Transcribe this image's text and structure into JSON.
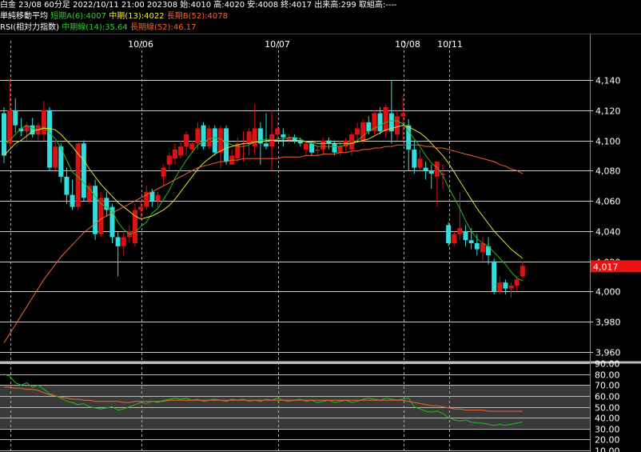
{
  "header": {
    "line1": "白金 23/08 60分足 2022/10/11 21:00 202308 始:4010 高:4020 安:4008 終:4017 出来高:299 取組高:----",
    "ma_title": "単純移動平均",
    "ma_short": "短期A(6):4007",
    "ma_mid": "中期(13):4022",
    "ma_long": "長期B(52):4078",
    "rsi_title": "RSI(相対力指数)",
    "rsi_mid": "中期線(14):35.64",
    "rsi_long": "長期線(52):46.17"
  },
  "colors": {
    "background": "#000000",
    "up": "#dd1111",
    "down": "#33dddd",
    "ma_short": "#22bb22",
    "ma_mid": "#dddd33",
    "ma_long": "#ee6633",
    "rsi_mid": "#22bb22",
    "rsi_long": "#ee6633",
    "price_tag": "#ee1111"
  },
  "chart_data": [
    {
      "type": "candlestick",
      "title": "白金 23/08 60分足",
      "x_labels": [
        "10/06",
        "10/07",
        "10/08",
        "10/11"
      ],
      "y_ticks": [
        3960,
        3980,
        4000,
        4020,
        4040,
        4060,
        4080,
        4100,
        4120,
        4140
      ],
      "ylim": [
        3955,
        4155
      ],
      "last_price_label": "4,017",
      "candles": [
        {
          "o": 4118,
          "h": 4122,
          "l": 4085,
          "c": 4090
        },
        {
          "o": 4098,
          "h": 4140,
          "l": 4096,
          "c": 4120
        },
        {
          "o": 4120,
          "h": 4128,
          "l": 4105,
          "c": 4110
        },
        {
          "o": 4108,
          "h": 4115,
          "l": 4103,
          "c": 4106
        },
        {
          "o": 4106,
          "h": 4112,
          "l": 4100,
          "c": 4110
        },
        {
          "o": 4110,
          "h": 4115,
          "l": 4102,
          "c": 4104
        },
        {
          "o": 4104,
          "h": 4112,
          "l": 4100,
          "c": 4110
        },
        {
          "o": 4104,
          "h": 4126,
          "l": 4100,
          "c": 4120
        },
        {
          "o": 4120,
          "h": 4122,
          "l": 4080,
          "c": 4082
        },
        {
          "o": 4082,
          "h": 4100,
          "l": 4080,
          "c": 4096
        },
        {
          "o": 4096,
          "h": 4098,
          "l": 4072,
          "c": 4076
        },
        {
          "o": 4076,
          "h": 4082,
          "l": 4058,
          "c": 4064
        },
        {
          "o": 4064,
          "h": 4074,
          "l": 4054,
          "c": 4056
        },
        {
          "o": 4056,
          "h": 4098,
          "l": 4054,
          "c": 4098
        },
        {
          "o": 4098,
          "h": 4100,
          "l": 4060,
          "c": 4062
        },
        {
          "o": 4060,
          "h": 4072,
          "l": 4058,
          "c": 4070
        },
        {
          "o": 4070,
          "h": 4074,
          "l": 4034,
          "c": 4038
        },
        {
          "o": 4038,
          "h": 4066,
          "l": 4036,
          "c": 4062
        },
        {
          "o": 4062,
          "h": 4066,
          "l": 4050,
          "c": 4054
        },
        {
          "o": 4056,
          "h": 4058,
          "l": 4032,
          "c": 4036
        },
        {
          "o": 4036,
          "h": 4040,
          "l": 4010,
          "c": 4030
        },
        {
          "o": 4030,
          "h": 4040,
          "l": 4024,
          "c": 4036
        },
        {
          "o": 4036,
          "h": 4044,
          "l": 4032,
          "c": 4040
        },
        {
          "o": 4032,
          "h": 4058,
          "l": 4030,
          "c": 4054
        },
        {
          "o": 4054,
          "h": 4060,
          "l": 4048,
          "c": 4056
        },
        {
          "o": 4056,
          "h": 4070,
          "l": 4054,
          "c": 4066
        },
        {
          "o": 4066,
          "h": 4068,
          "l": 4056,
          "c": 4060
        },
        {
          "o": 4060,
          "h": 4066,
          "l": 4056,
          "c": 4064
        },
        {
          "o": 4076,
          "h": 4084,
          "l": 4070,
          "c": 4082
        },
        {
          "o": 4084,
          "h": 4092,
          "l": 4080,
          "c": 4090
        },
        {
          "o": 4088,
          "h": 4098,
          "l": 4084,
          "c": 4094
        },
        {
          "o": 4090,
          "h": 4100,
          "l": 4088,
          "c": 4096
        },
        {
          "o": 4096,
          "h": 4106,
          "l": 4090,
          "c": 4104
        },
        {
          "o": 4094,
          "h": 4100,
          "l": 4092,
          "c": 4098
        },
        {
          "o": 4098,
          "h": 4112,
          "l": 4094,
          "c": 4108
        },
        {
          "o": 4110,
          "h": 4112,
          "l": 4094,
          "c": 4096
        },
        {
          "o": 4096,
          "h": 4110,
          "l": 4094,
          "c": 4108
        },
        {
          "o": 4108,
          "h": 4110,
          "l": 4090,
          "c": 4092
        },
        {
          "o": 4092,
          "h": 4110,
          "l": 4082,
          "c": 4108
        },
        {
          "o": 4108,
          "h": 4110,
          "l": 4084,
          "c": 4086
        },
        {
          "o": 4084,
          "h": 4094,
          "l": 4084,
          "c": 4090
        },
        {
          "o": 4088,
          "h": 4102,
          "l": 4086,
          "c": 4098
        },
        {
          "o": 4098,
          "h": 4106,
          "l": 4086,
          "c": 4098
        },
        {
          "o": 4098,
          "h": 4108,
          "l": 4090,
          "c": 4106
        },
        {
          "o": 4096,
          "h": 4124,
          "l": 4090,
          "c": 4108
        },
        {
          "o": 4108,
          "h": 4112,
          "l": 4084,
          "c": 4098
        },
        {
          "o": 4098,
          "h": 4118,
          "l": 4094,
          "c": 4096
        },
        {
          "o": 4096,
          "h": 4120,
          "l": 4080,
          "c": 4104
        },
        {
          "o": 4104,
          "h": 4112,
          "l": 4100,
          "c": 4108
        },
        {
          "o": 4104,
          "h": 4108,
          "l": 4096,
          "c": 4102
        },
        {
          "o": 4100,
          "h": 4104,
          "l": 4098,
          "c": 4102
        },
        {
          "o": 4102,
          "h": 4104,
          "l": 4098,
          "c": 4100
        },
        {
          "o": 4100,
          "h": 4102,
          "l": 4096,
          "c": 4098
        },
        {
          "o": 4094,
          "h": 4100,
          "l": 4090,
          "c": 4098
        },
        {
          "o": 4098,
          "h": 4100,
          "l": 4090,
          "c": 4092
        },
        {
          "o": 4094,
          "h": 4096,
          "l": 4090,
          "c": 4094
        },
        {
          "o": 4094,
          "h": 4102,
          "l": 4090,
          "c": 4100
        },
        {
          "o": 4100,
          "h": 4102,
          "l": 4094,
          "c": 4098
        },
        {
          "o": 4098,
          "h": 4100,
          "l": 4090,
          "c": 4092
        },
        {
          "o": 4092,
          "h": 4100,
          "l": 4090,
          "c": 4096
        },
        {
          "o": 4096,
          "h": 4102,
          "l": 4092,
          "c": 4100
        },
        {
          "o": 4094,
          "h": 4106,
          "l": 4090,
          "c": 4104
        },
        {
          "o": 4104,
          "h": 4112,
          "l": 4100,
          "c": 4108
        },
        {
          "o": 4100,
          "h": 4114,
          "l": 4098,
          "c": 4112
        },
        {
          "o": 4112,
          "h": 4116,
          "l": 4104,
          "c": 4106
        },
        {
          "o": 4106,
          "h": 4120,
          "l": 4104,
          "c": 4118
        },
        {
          "o": 4118,
          "h": 4122,
          "l": 4104,
          "c": 4106
        },
        {
          "o": 4106,
          "h": 4124,
          "l": 4102,
          "c": 4122
        },
        {
          "o": 4118,
          "h": 4140,
          "l": 4098,
          "c": 4106
        },
        {
          "o": 4104,
          "h": 4120,
          "l": 4100,
          "c": 4116
        },
        {
          "o": 4116,
          "h": 4130,
          "l": 4100,
          "c": 4118
        },
        {
          "o": 4110,
          "h": 4114,
          "l": 4080,
          "c": 4094
        },
        {
          "o": 4094,
          "h": 4100,
          "l": 4078,
          "c": 4082
        },
        {
          "o": 4082,
          "h": 4094,
          "l": 4080,
          "c": 4088
        },
        {
          "o": 4082,
          "h": 4086,
          "l": 4074,
          "c": 4080
        },
        {
          "o": 4080,
          "h": 4084,
          "l": 4068,
          "c": 4078
        },
        {
          "o": 4076,
          "h": 4086,
          "l": 4056,
          "c": 4086
        },
        {
          "o": 4078,
          "h": 4084,
          "l": 4068,
          "c": 4078
        },
        {
          "o": 4044,
          "h": 4046,
          "l": 4030,
          "c": 4032
        },
        {
          "o": 4032,
          "h": 4040,
          "l": 4030,
          "c": 4038
        },
        {
          "o": 4038,
          "h": 4066,
          "l": 4034,
          "c": 4042
        },
        {
          "o": 4040,
          "h": 4044,
          "l": 4030,
          "c": 4034
        },
        {
          "o": 4034,
          "h": 4042,
          "l": 4028,
          "c": 4032
        },
        {
          "o": 4032,
          "h": 4038,
          "l": 4024,
          "c": 4028
        },
        {
          "o": 4026,
          "h": 4036,
          "l": 4020,
          "c": 4032
        },
        {
          "o": 4030,
          "h": 4036,
          "l": 4018,
          "c": 4024
        },
        {
          "o": 4020,
          "h": 4022,
          "l": 3998,
          "c": 4000
        },
        {
          "o": 4000,
          "h": 4010,
          "l": 3998,
          "c": 4006
        },
        {
          "o": 4006,
          "h": 4008,
          "l": 3998,
          "c": 4002
        },
        {
          "o": 4002,
          "h": 4006,
          "l": 3996,
          "c": 4004
        },
        {
          "o": 4004,
          "h": 4010,
          "l": 4000,
          "c": 4008
        },
        {
          "o": 4010,
          "h": 4020,
          "l": 4008,
          "c": 4017
        }
      ],
      "series": [
        {
          "name": "短期A(6)",
          "values": [
            4098,
            4100,
            4104,
            4108,
            4110,
            4108,
            4107,
            4109,
            4105,
            4101,
            4095,
            4087,
            4079,
            4076,
            4072,
            4068,
            4063,
            4058,
            4056,
            4053,
            4046,
            4041,
            4038,
            4039,
            4043,
            4046,
            4052,
            4055,
            4061,
            4067,
            4075,
            4081,
            4087,
            4092,
            4097,
            4099,
            4101,
            4102,
            4101,
            4099,
            4097,
            4096,
            4096,
            4097,
            4099,
            4100,
            4101,
            4100,
            4101,
            4101,
            4102,
            4102,
            4101,
            4099,
            4098,
            4096,
            4096,
            4096,
            4096,
            4096,
            4097,
            4098,
            4100,
            4103,
            4106,
            4108,
            4110,
            4112,
            4113,
            4113,
            4111,
            4106,
            4101,
            4096,
            4090,
            4085,
            4082,
            4077,
            4069,
            4062,
            4055,
            4047,
            4040,
            4035,
            4032,
            4030,
            4026,
            4022,
            4018,
            4013,
            4009,
            4007
          ]
        },
        {
          "name": "中期(13)",
          "values": [
            4090,
            4094,
            4098,
            4100,
            4103,
            4106,
            4107,
            4108,
            4108,
            4107,
            4104,
            4100,
            4096,
            4091,
            4087,
            4081,
            4076,
            4071,
            4067,
            4063,
            4059,
            4056,
            4053,
            4050,
            4048,
            4049,
            4050,
            4052,
            4054,
            4057,
            4061,
            4066,
            4071,
            4076,
            4081,
            4085,
            4088,
            4091,
            4093,
            4095,
            4096,
            4097,
            4098,
            4098,
            4099,
            4099,
            4100,
            4100,
            4100,
            4100,
            4100,
            4100,
            4100,
            4099,
            4099,
            4098,
            4098,
            4098,
            4098,
            4098,
            4098,
            4098,
            4099,
            4100,
            4101,
            4103,
            4105,
            4107,
            4108,
            4109,
            4110,
            4109,
            4107,
            4105,
            4102,
            4098,
            4094,
            4090,
            4085,
            4079,
            4073,
            4067,
            4061,
            4055,
            4050,
            4045,
            4040,
            4036,
            4032,
            4028,
            4025,
            4022
          ]
        },
        {
          "name": "長期B(52)",
          "values": [
            3966,
            3972,
            3978,
            3984,
            3990,
            3996,
            4002,
            4008,
            4013,
            4018,
            4023,
            4027,
            4031,
            4035,
            4039,
            4042,
            4045,
            4048,
            4050,
            4052,
            4054,
            4056,
            4058,
            4060,
            4062,
            4064,
            4066,
            4068,
            4070,
            4072,
            4074,
            4076,
            4078,
            4080,
            4082,
            4083,
            4084,
            4085,
            4086,
            4086,
            4087,
            4087,
            4088,
            4088,
            4088,
            4088,
            4088,
            4088,
            4088,
            4089,
            4089,
            4089,
            4089,
            4090,
            4090,
            4090,
            4091,
            4091,
            4091,
            4092,
            4092,
            4093,
            4093,
            4094,
            4094,
            4095,
            4095,
            4096,
            4096,
            4097,
            4097,
            4097,
            4097,
            4097,
            4096,
            4096,
            4095,
            4095,
            4094,
            4093,
            4092,
            4091,
            4090,
            4089,
            4088,
            4087,
            4086,
            4084,
            4083,
            4081,
            4080,
            4078
          ]
        }
      ]
    },
    {
      "type": "line",
      "title": "RSI(相対力指数)",
      "y_ticks": [
        10,
        20,
        30,
        40,
        50,
        60,
        70,
        80,
        90
      ],
      "ylim": [
        10,
        90
      ],
      "series": [
        {
          "name": "中期線(14)",
          "values": [
            80,
            78,
            72,
            70,
            72,
            68,
            70,
            66,
            62,
            60,
            58,
            55,
            54,
            52,
            53,
            50,
            49,
            48,
            49,
            50,
            47,
            48,
            50,
            52,
            54,
            53,
            55,
            54,
            56,
            57,
            58,
            57,
            58,
            56,
            57,
            55,
            56,
            57,
            56,
            55,
            57,
            56,
            57,
            55,
            56,
            55,
            57,
            56,
            58,
            56,
            55,
            56,
            57,
            55,
            56,
            54,
            55,
            56,
            54,
            55,
            56,
            54,
            55,
            57,
            58,
            57,
            56,
            58,
            57,
            56,
            57,
            58,
            50,
            48,
            46,
            45,
            46,
            44,
            40,
            38,
            37,
            38,
            36,
            35,
            35,
            34,
            33,
            34,
            33,
            34,
            35,
            36
          ]
        },
        {
          "name": "長期線(52)",
          "values": [
            68,
            68,
            67,
            67,
            66,
            66,
            65,
            63,
            61,
            60,
            59,
            58,
            57,
            57,
            56,
            56,
            55,
            55,
            55,
            55,
            55,
            54,
            54,
            55,
            55,
            55,
            55,
            55,
            55,
            56,
            56,
            56,
            56,
            56,
            56,
            56,
            56,
            56,
            56,
            56,
            56,
            56,
            56,
            56,
            56,
            56,
            56,
            56,
            56,
            56,
            56,
            56,
            56,
            56,
            56,
            56,
            56,
            56,
            56,
            56,
            56,
            56,
            56,
            56,
            56,
            56,
            56,
            56,
            56,
            56,
            56,
            55,
            54,
            53,
            52,
            51,
            51,
            50,
            49,
            48,
            48,
            47,
            47,
            47,
            47,
            46,
            46,
            46,
            46,
            46,
            46,
            46
          ]
        }
      ]
    }
  ]
}
